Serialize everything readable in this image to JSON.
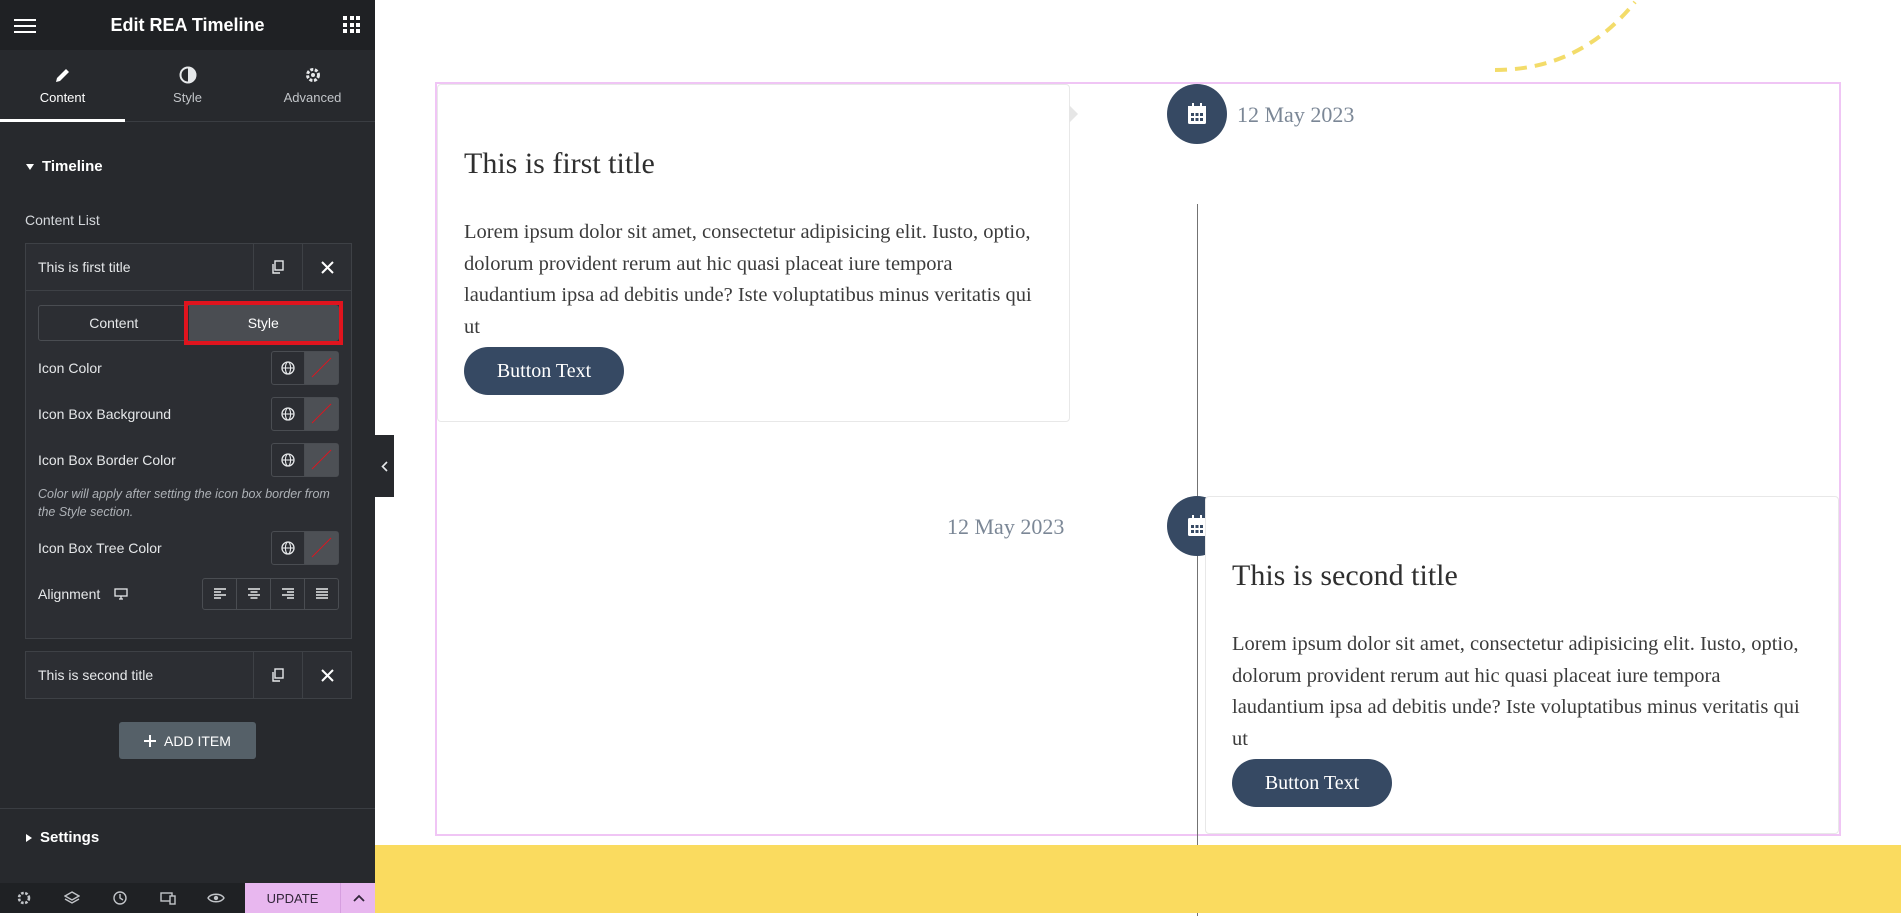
{
  "header": {
    "title": "Edit REA Timeline"
  },
  "tabs": [
    {
      "label": "Content",
      "icon": "pencil-icon"
    },
    {
      "label": "Style",
      "icon": "half-circle-icon"
    },
    {
      "label": "Advanced",
      "icon": "gear-icon"
    }
  ],
  "panel": {
    "section_title": "Timeline",
    "content_list_label": "Content List",
    "items": [
      {
        "title": "This is first title"
      },
      {
        "title": "This is second title"
      }
    ],
    "inner_tabs": {
      "content": "Content",
      "style": "Style"
    },
    "fields": {
      "icon_color": "Icon Color",
      "icon_box_bg": "Icon Box Background",
      "icon_box_border": "Icon Box Border Color",
      "note": "Color will apply after setting the icon box border from the Style section.",
      "icon_box_tree": "Icon Box Tree Color",
      "alignment": "Alignment"
    },
    "add_item": "ADD ITEM",
    "settings_title": "Settings"
  },
  "footer": {
    "update_label": "UPDATE"
  },
  "timeline": [
    {
      "title": "This is first title",
      "body": "Lorem ipsum dolor sit amet, consectetur adipisicing elit. Iusto, optio, dolorum provident rerum aut hic quasi placeat iure tempora laudantium ipsa ad debitis unde? Iste voluptatibus minus veritatis qui ut",
      "button": "Button Text",
      "date": "12 May 2023"
    },
    {
      "title": "This is second title",
      "body": "Lorem ipsum dolor sit amet, consectetur adipisicing elit. Iusto, optio, dolorum provident rerum aut hic quasi placeat iure tempora laudantium ipsa ad debitis unde? Iste voluptatibus minus veritatis qui ut",
      "button": "Button Text",
      "date": "12 May 2023"
    }
  ],
  "colors": {
    "accent": "#364963",
    "highlight": "#e0141e",
    "update_bg": "#e8b7ef",
    "wrapper_border": "#f0c5f5",
    "footer_band": "#fadb5f"
  }
}
